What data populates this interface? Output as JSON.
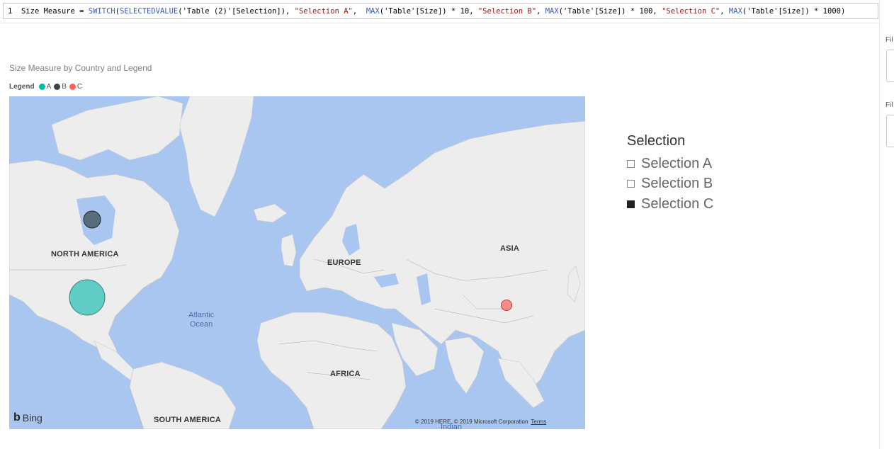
{
  "formula": {
    "line_number": "1",
    "measure_name": "Size Measure",
    "operator": "=",
    "fn_switch": "SWITCH",
    "open": "(",
    "fn_selectedvalue": "SELECTEDVALUE",
    "arg_table2": "('Table (2)'[Selection]), ",
    "str_a": "\"Selection A\"",
    "comma_sp2": ",  ",
    "fn_max1": "MAX",
    "expr1": "('Table'[Size]) * 10, ",
    "str_b": "\"Selection B\"",
    "comma_sp": ", ",
    "fn_max2": "MAX",
    "expr2": "('Table'[Size]) * 100, ",
    "str_c": "\"Selection C\"",
    "comma_sp3": ", ",
    "fn_max3": "MAX",
    "expr3": "('Table'[Size]) * 1000",
    "close": ")"
  },
  "right_pane": {
    "label1": "Fil",
    "label2": "Fil"
  },
  "visual": {
    "title": "Size Measure by Country and Legend",
    "legend_title": "Legend",
    "legend_items": [
      {
        "label": "A",
        "color": "#01b8aa"
      },
      {
        "label": "B",
        "color": "#374649"
      },
      {
        "label": "C",
        "color": "#fd625e"
      }
    ]
  },
  "map": {
    "labels": {
      "north_america": "NORTH AMERICA",
      "europe": "EUROPE",
      "asia": "ASIA",
      "africa": "AFRICA",
      "south_america": "SOUTH AMERICA",
      "indian": "Indian"
    },
    "ocean": {
      "line1": "Atlantic",
      "line2": "Ocean"
    },
    "bing": "Bing",
    "copyright": "© 2019 HERE, © 2019 Microsoft Corporation",
    "terms": "Terms",
    "colors": {
      "water": "#a9c6f0",
      "land": "#ededed",
      "border": "#9a9a9a"
    }
  },
  "bubbles": [
    {
      "legend": "A",
      "color": "#01b8aa"
    },
    {
      "legend": "B",
      "color": "#374649"
    },
    {
      "legend": "C",
      "color": "#fd625e"
    }
  ],
  "slicer": {
    "title": "Selection",
    "items": [
      {
        "label": "Selection A",
        "checked": false
      },
      {
        "label": "Selection B",
        "checked": false
      },
      {
        "label": "Selection C",
        "checked": true
      }
    ]
  }
}
